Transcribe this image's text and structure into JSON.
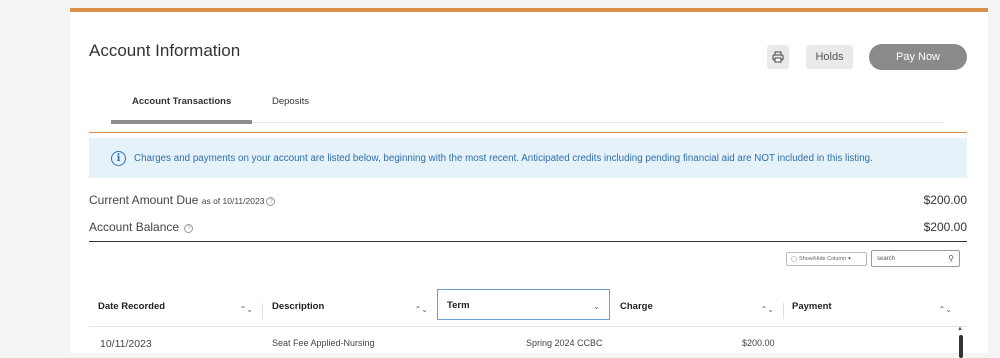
{
  "header": {
    "title": "Account Information",
    "holds_label": "Holds",
    "pay_now_label": "Pay Now"
  },
  "tabs": [
    {
      "label": "Account Transactions",
      "active": true
    },
    {
      "label": "Deposits",
      "active": false
    }
  ],
  "info": {
    "text": "Charges and payments on your account are listed below, beginning with the most recent. Anticipated credits including pending financial aid are NOT included in this listing."
  },
  "summary": {
    "current_due_label": "Current Amount Due",
    "current_due_date": "as of 10/11/2023",
    "current_due_amount": "$200.00",
    "balance_label": "Account Balance",
    "balance_amount": "$200.00"
  },
  "table_controls": {
    "show_hide_label": "Show/Hide Column",
    "search_placeholder": "search"
  },
  "table": {
    "columns": [
      "Date Recorded",
      "Description",
      "Term",
      "Charge",
      "Payment"
    ],
    "rows": [
      {
        "date": "10/11/2023",
        "description": "Seat Fee Applied-Nursing",
        "term": "Spring 2024 CCBC",
        "charge": "$200.00",
        "payment": ""
      }
    ]
  },
  "colors": {
    "accent": "#d9904a",
    "info_bg": "#e6f2fa",
    "info_text": "#2f6ea8",
    "pay_button": "#8a8a8a"
  }
}
